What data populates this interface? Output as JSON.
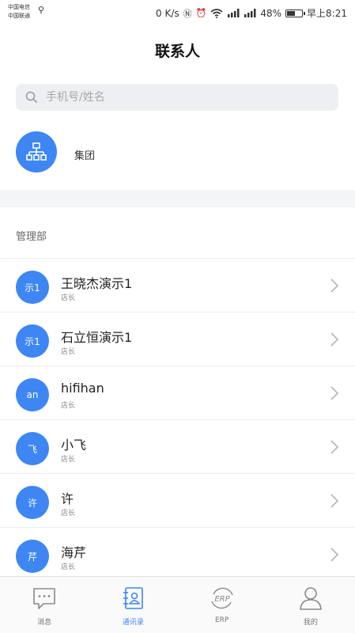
{
  "status_bar": {
    "carrier_1": "中国电信",
    "carrier_2": "中国联通",
    "speed": "0 K/s",
    "battery": "48%",
    "time": "早上8:21"
  },
  "header": {
    "title": "联系人"
  },
  "search": {
    "placeholder": "手机号/姓名"
  },
  "group": {
    "label": "集团",
    "icon": "org-chart-icon"
  },
  "section": {
    "title": "管理部"
  },
  "contacts": [
    {
      "avatar_text": "示1",
      "name": "王晓杰演示1",
      "role": "店长"
    },
    {
      "avatar_text": "示1",
      "name": "石立恒演示1",
      "role": "店长"
    },
    {
      "avatar_text": "an",
      "name": "hifihan",
      "role": "店长"
    },
    {
      "avatar_text": "飞",
      "name": "小飞",
      "role": "店长"
    },
    {
      "avatar_text": "许",
      "name": "许",
      "role": "店长"
    },
    {
      "avatar_text": "芹",
      "name": "海芹",
      "role": "店长"
    }
  ],
  "tabbar": [
    {
      "label": "消息",
      "icon": "message-icon",
      "active": false
    },
    {
      "label": "通讯录",
      "icon": "contacts-icon",
      "active": true
    },
    {
      "label": "ERP",
      "icon": "erp-icon",
      "active": false
    },
    {
      "label": "我的",
      "icon": "profile-icon",
      "active": false
    }
  ],
  "colors": {
    "accent": "#3d86f4",
    "search_bg": "#eeeff2",
    "divider_band": "#f4f5f7"
  }
}
